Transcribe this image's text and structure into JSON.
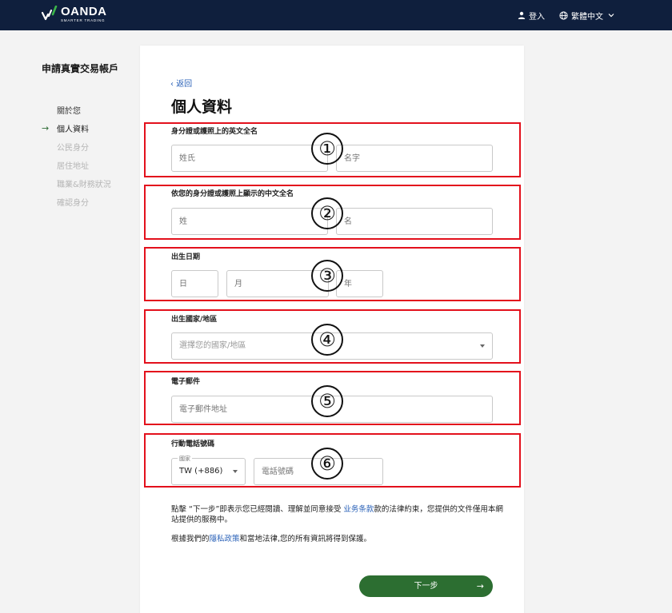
{
  "header": {
    "logo_name": "OANDA",
    "logo_tagline": "SMARTER TRADING",
    "login_label": "登入",
    "language_label": "繁體中文"
  },
  "sidebar": {
    "title": "申請真實交易帳戶",
    "steps": [
      {
        "label": "關於您",
        "state": "done"
      },
      {
        "label": "個人資料",
        "state": "active"
      },
      {
        "label": "公民身分",
        "state": "pending"
      },
      {
        "label": "居住地址",
        "state": "pending"
      },
      {
        "label": "職業&財務狀況",
        "state": "pending"
      },
      {
        "label": "確認身分",
        "state": "pending"
      }
    ]
  },
  "main": {
    "back_label": "返回",
    "title": "個人資料",
    "sections": {
      "english_name": {
        "number": "①",
        "label": "身分證或護照上的英文全名",
        "last_name_placeholder": "姓氏",
        "first_name_placeholder": "名字"
      },
      "chinese_name": {
        "number": "②",
        "label": "依您的身分證或護照上顯示的中文全名",
        "last_name_placeholder": "姓",
        "first_name_placeholder": "名"
      },
      "birth_date": {
        "number": "③",
        "label": "出生日期",
        "day_placeholder": "日",
        "month_placeholder": "月",
        "year_placeholder": "年"
      },
      "birth_country": {
        "number": "④",
        "label": "出生國家/地區",
        "placeholder": "選擇您的國家/地區"
      },
      "email": {
        "number": "⑤",
        "label": "電子郵件",
        "placeholder": "電子郵件地址"
      },
      "mobile": {
        "number": "⑥",
        "label": "行動電話號碼",
        "country_label": "國家",
        "country_value": "TW (+886)",
        "phone_placeholder": "電話號碼"
      }
    },
    "terms": {
      "prefix": "點擊 “下一步”即表示您已經閱讀、理解並同意接受 ",
      "link": "业务条款",
      "suffix": "款的法律約束，您提供的文件僅用本網站提供的服務中。"
    },
    "privacy": {
      "prefix": "根據我們的",
      "link": "隱私政策",
      "suffix": "和當地法律,您的所有資訊將得到保護。"
    },
    "next_label": "下一步"
  },
  "colors": {
    "header_bg": "#0f1f3d",
    "accent_green": "#2c6e31",
    "link_blue": "#2b62b8",
    "annotation_red": "#e3101c"
  }
}
